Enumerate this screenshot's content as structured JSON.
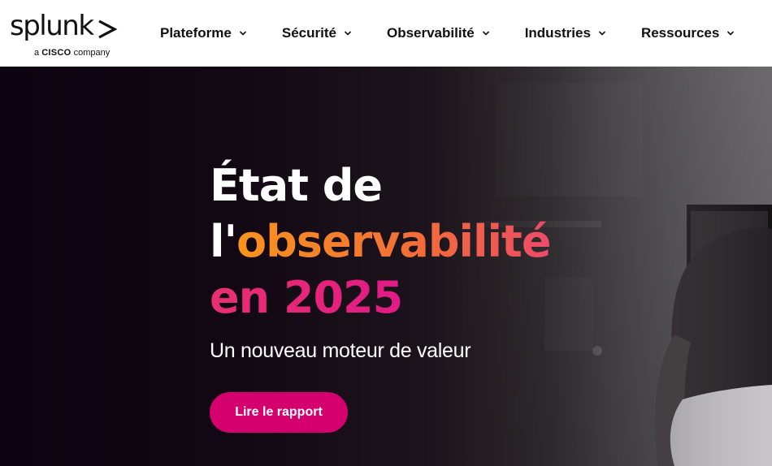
{
  "brand": {
    "wordmark": "splunk",
    "sub_prefix": "a",
    "sub_company": "CISCO",
    "sub_suffix": "company"
  },
  "nav": {
    "items": [
      {
        "label": "Plateforme"
      },
      {
        "label": "Sécurité"
      },
      {
        "label": "Observabilité"
      },
      {
        "label": "Industries"
      },
      {
        "label": "Ressources"
      }
    ]
  },
  "hero": {
    "title_line1": "État de",
    "title_line2_prefix": "l'",
    "title_line2_accent": "observabilité",
    "title_line3": "en 2025",
    "subtitle": "Un nouveau moteur de valeur",
    "cta_label": "Lire le rapport"
  },
  "colors": {
    "header_bg": "#ffffff",
    "hero_bg": "#0c0410",
    "accent_orange": "#f7941d",
    "accent_pink": "#e21a86",
    "cta_bg": "#d4006e"
  },
  "icons": {
    "nav_dropdown": "chevron-down-icon",
    "logo": "splunk-chevron-icon"
  }
}
